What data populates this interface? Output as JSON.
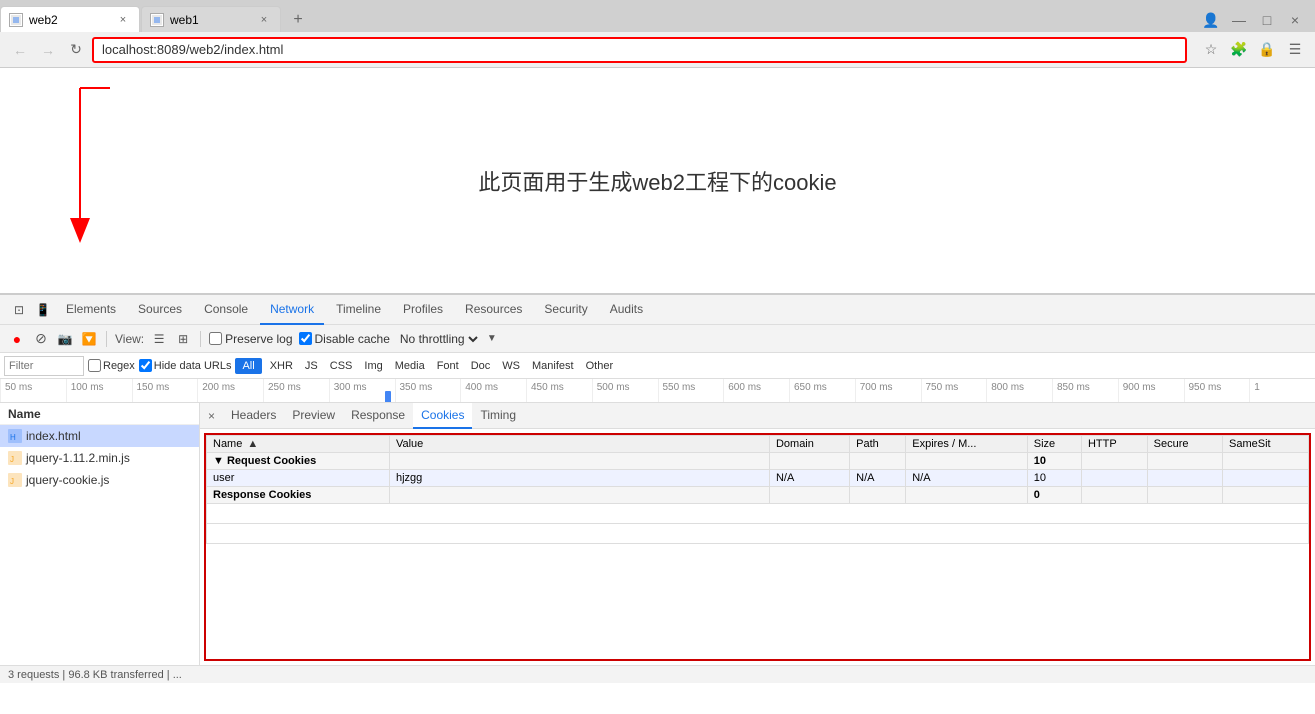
{
  "browser": {
    "tabs": [
      {
        "id": "web2",
        "title": "web2",
        "active": true,
        "url": "localhost:8089/web2/index.html"
      },
      {
        "id": "web1",
        "title": "web1",
        "active": false,
        "url": ""
      }
    ],
    "address": "localhost:8089/web2/index.html"
  },
  "page": {
    "content": "此页面用于生成web2工程下的cookie"
  },
  "devtools": {
    "tabs": [
      {
        "id": "elements",
        "label": "Elements"
      },
      {
        "id": "sources",
        "label": "Sources"
      },
      {
        "id": "console",
        "label": "Console"
      },
      {
        "id": "network",
        "label": "Network",
        "active": true
      },
      {
        "id": "timeline",
        "label": "Timeline"
      },
      {
        "id": "profiles",
        "label": "Profiles"
      },
      {
        "id": "resources",
        "label": "Resources"
      },
      {
        "id": "security",
        "label": "Security"
      },
      {
        "id": "audits",
        "label": "Audits"
      }
    ],
    "toolbar": {
      "preserve_log_label": "Preserve log",
      "disable_cache_label": "Disable cache",
      "throttle_label": "No throttling",
      "view_label": "View:"
    },
    "filter": {
      "placeholder": "Filter",
      "regex_label": "Regex",
      "hide_data_urls_label": "Hide data URLs",
      "all_label": "All",
      "types": [
        "XHR",
        "JS",
        "CSS",
        "Img",
        "Media",
        "Font",
        "Doc",
        "WS",
        "Manifest",
        "Other"
      ]
    },
    "timeline": {
      "marks": [
        "50 ms",
        "100 ms",
        "150 ms",
        "200 ms",
        "250 ms",
        "300 ms",
        "350 ms",
        "400 ms",
        "450 ms",
        "500 ms",
        "550 ms",
        "600 ms",
        "650 ms",
        "700 ms",
        "750 ms",
        "800 ms",
        "850 ms",
        "900 ms",
        "950 ms",
        "1"
      ]
    },
    "file_panel": {
      "header": "Name",
      "files": [
        {
          "name": "index.html",
          "selected": true
        },
        {
          "name": "jquery-1.11.2.min.js",
          "selected": false
        },
        {
          "name": "jquery-cookie.js",
          "selected": false
        }
      ]
    },
    "cookies_panel": {
      "close_icon": "×",
      "tabs": [
        {
          "label": "Headers"
        },
        {
          "label": "Preview"
        },
        {
          "label": "Response"
        },
        {
          "label": "Cookies",
          "active": true
        },
        {
          "label": "Timing"
        }
      ],
      "table": {
        "headers": [
          "Name",
          "Value",
          "Domain",
          "Path",
          "Expires / M...",
          "Size",
          "HTTP",
          "Secure",
          "SameSit"
        ],
        "sections": [
          {
            "type": "section",
            "label": "▼ Request Cookies",
            "size": "10",
            "rows": [
              {
                "name": "user",
                "value": "hjzgg",
                "domain": "N/A",
                "path": "N/A",
                "expires": "N/A",
                "size": "10",
                "http": "",
                "secure": "",
                "samesite": ""
              }
            ]
          },
          {
            "type": "section",
            "label": "Response Cookies",
            "size": "0",
            "rows": []
          }
        ]
      }
    },
    "status": {
      "text": "3 requests | 96.8 KB transferred | ..."
    }
  }
}
